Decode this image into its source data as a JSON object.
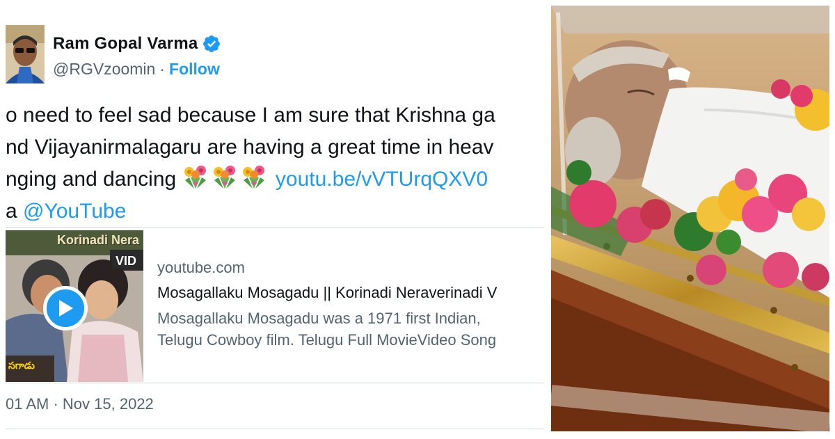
{
  "tweet": {
    "author": {
      "name": "Ram Gopal Varma",
      "handle": "@RGVzoomin",
      "separator": "·",
      "follow_label": "Follow",
      "verified_icon": "verified-badge-icon"
    },
    "text": {
      "line1": "o need to feel sad because I am sure that Krishna ga",
      "line2": "nd Vijayanirmalagaru are having a great time in heav",
      "line3_prefix": "nging and dancing",
      "line3_link": "youtu.be/vVTUrqQXV0",
      "line4_prefix": "a",
      "line4_mention": "@YouTube",
      "emoji": "bouquet"
    },
    "card": {
      "thumb_title": "Korinadi Nera",
      "thumb_sub": "VID",
      "thumb_caption": "సగాడు",
      "domain": "youtube.com",
      "title": "Mosagallaku Mosagadu || Korinadi Neraverinadi V",
      "desc_line1": "Mosagallaku Mosagadu was a 1971 first Indian,",
      "desc_line2": "Telugu Cowboy film. Telugu Full MovieVideo Song"
    },
    "timestamp": "01 AM · Nov 15, 2022"
  },
  "colors": {
    "accent": "#1d9bf0",
    "text_primary": "#0f1419",
    "text_secondary": "#536471",
    "divider": "#cfd9de"
  }
}
